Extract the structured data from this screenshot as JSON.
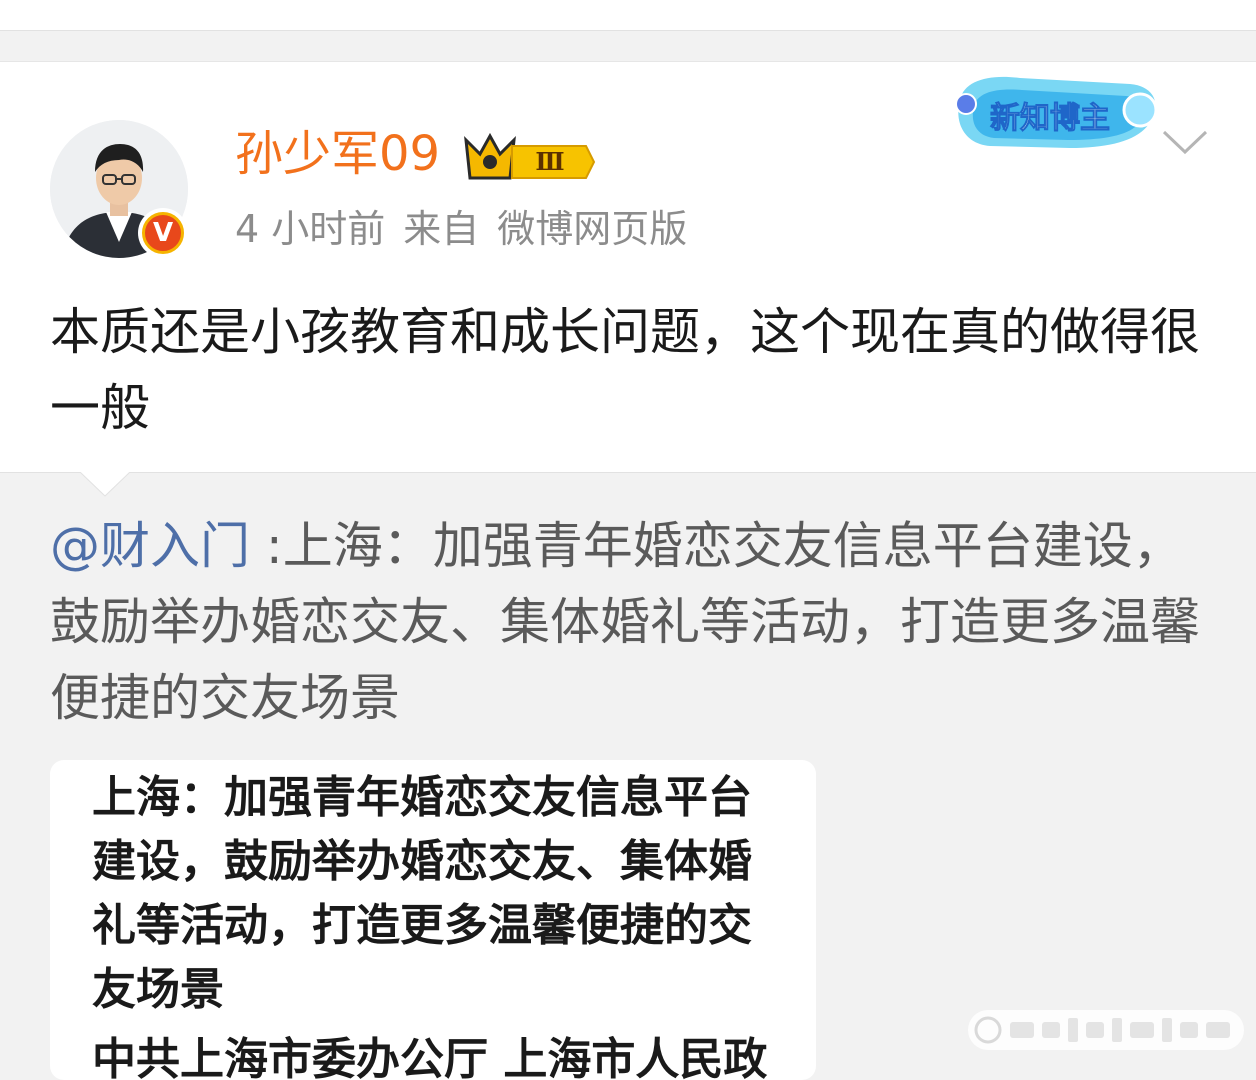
{
  "post": {
    "username": "孙少军09",
    "level_badge": "Ⅲ",
    "verified_mark": "V",
    "time": "4 小时前",
    "source_prefix": "来自",
    "source": "微博网页版",
    "top_badge": "新知博主",
    "text": "本质还是小孩教育和成长问题，这个现在真的做得很一般"
  },
  "repost": {
    "mention": "@财入门",
    "text": " :上海：加强青年婚恋交友信息平台建设，鼓励举办婚恋交友、集体婚礼等活动，打造更多温馨便捷的交友场景",
    "image_title": "上海：加强青年婚恋交友信息平台建设，鼓励举办婚恋交友、集体婚礼等活动，打造更多温馨便捷的交友场景",
    "image_next_line": "中共上海市委办公厅 上海市人民政"
  },
  "colors": {
    "username": "#f2711c",
    "mention": "#4e6fa8",
    "meta": "#8c8c8c"
  }
}
